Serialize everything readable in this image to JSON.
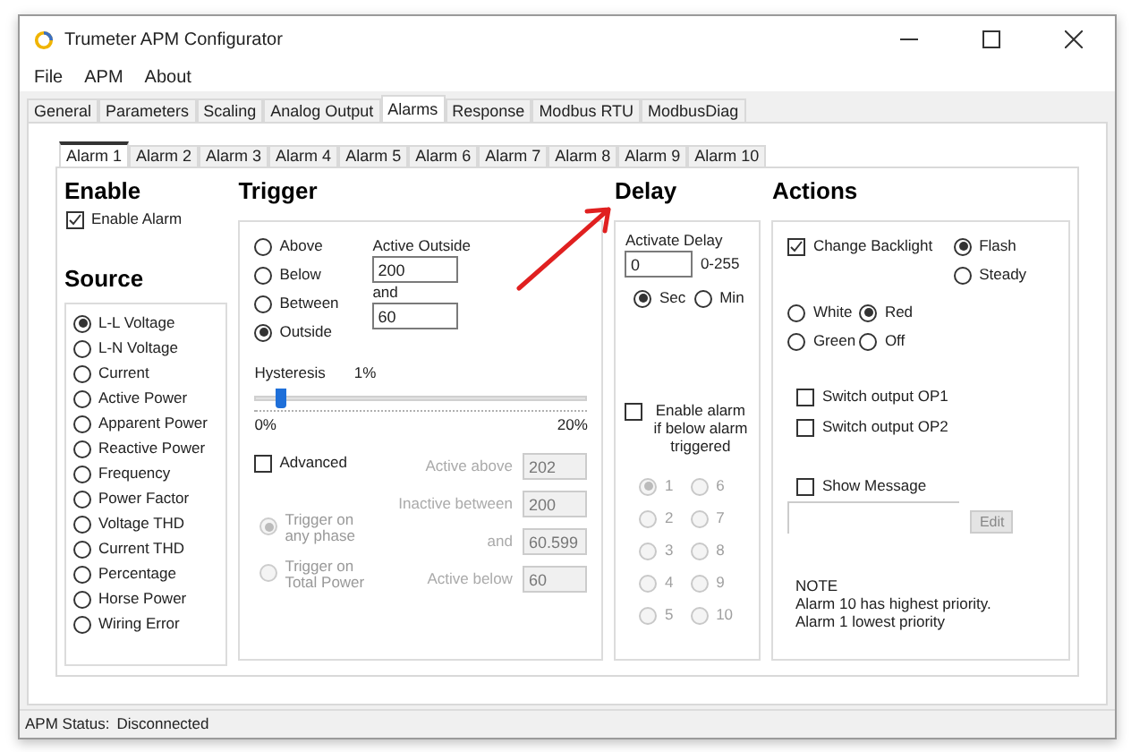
{
  "window": {
    "title": "Trumeter APM Configurator"
  },
  "menu": [
    "File",
    "APM",
    "About"
  ],
  "tabs": [
    {
      "label": "General",
      "selected": false
    },
    {
      "label": "Parameters",
      "selected": false
    },
    {
      "label": "Scaling",
      "selected": false
    },
    {
      "label": "Analog Output",
      "selected": false
    },
    {
      "label": "Alarms",
      "selected": true
    },
    {
      "label": "Response",
      "selected": false
    },
    {
      "label": "Modbus RTU",
      "selected": false
    },
    {
      "label": "ModbusDiag",
      "selected": false
    }
  ],
  "alarm_tabs": [
    {
      "label": "Alarm 1",
      "selected": true
    },
    {
      "label": "Alarm 2",
      "selected": false
    },
    {
      "label": "Alarm 3",
      "selected": false
    },
    {
      "label": "Alarm 4",
      "selected": false
    },
    {
      "label": "Alarm 5",
      "selected": false
    },
    {
      "label": "Alarm 6",
      "selected": false
    },
    {
      "label": "Alarm 7",
      "selected": false
    },
    {
      "label": "Alarm 8",
      "selected": false
    },
    {
      "label": "Alarm 9",
      "selected": false
    },
    {
      "label": "Alarm 10",
      "selected": false
    }
  ],
  "enable": {
    "heading": "Enable",
    "checkbox": {
      "label": "Enable Alarm",
      "checked": true
    }
  },
  "source": {
    "heading": "Source",
    "options": [
      {
        "label": "L-L Voltage",
        "selected": true
      },
      {
        "label": "L-N Voltage",
        "selected": false
      },
      {
        "label": "Current",
        "selected": false
      },
      {
        "label": "Active Power",
        "selected": false
      },
      {
        "label": "Apparent Power",
        "selected": false
      },
      {
        "label": "Reactive Power",
        "selected": false
      },
      {
        "label": "Frequency",
        "selected": false
      },
      {
        "label": "Power Factor",
        "selected": false
      },
      {
        "label": "Voltage THD",
        "selected": false
      },
      {
        "label": "Current THD",
        "selected": false
      },
      {
        "label": "Percentage",
        "selected": false
      },
      {
        "label": "Horse Power",
        "selected": false
      },
      {
        "label": "Wiring Error",
        "selected": false
      }
    ]
  },
  "trigger": {
    "heading": "Trigger",
    "modes": [
      {
        "label": "Above",
        "selected": false
      },
      {
        "label": "Below",
        "selected": false
      },
      {
        "label": "Between",
        "selected": false
      },
      {
        "label": "Outside",
        "selected": true
      }
    ],
    "active_label": "Active Outside",
    "value_1": "200",
    "and_label": "and",
    "value_2": "60",
    "hysteresis": {
      "label": "Hysteresis",
      "reading": "1%",
      "level": 0.05,
      "min": "0%",
      "max": "20%"
    },
    "advanced": {
      "label": "Advanced",
      "checked": false
    },
    "phase_options": [
      {
        "label": "Trigger on any phase",
        "selected": true,
        "disabled": true
      },
      {
        "label": "Trigger on Total Power",
        "selected": false,
        "disabled": true
      }
    ],
    "advanced_fields": [
      {
        "label": "Active above",
        "value": "202",
        "disabled": true
      },
      {
        "label": "Inactive between",
        "value": "200",
        "disabled": true
      },
      {
        "label": "and",
        "value": "60.599",
        "disabled": true
      },
      {
        "label": "Active below",
        "value": "60",
        "disabled": true
      }
    ]
  },
  "delay": {
    "heading": "Delay",
    "label": "Activate Delay",
    "value": "0",
    "range": "0-255",
    "units": [
      {
        "label": "Sec",
        "selected": true
      },
      {
        "label": "Min",
        "selected": false
      }
    ],
    "enable_below": {
      "label": "Enable alarm if below alarm triggered",
      "checked": false
    },
    "alarms": [
      {
        "label": "1",
        "selected": true,
        "disabled": true
      },
      {
        "label": "2",
        "selected": false,
        "disabled": true
      },
      {
        "label": "3",
        "selected": false,
        "disabled": true
      },
      {
        "label": "4",
        "selected": false,
        "disabled": true
      },
      {
        "label": "5",
        "selected": false,
        "disabled": true
      },
      {
        "label": "6",
        "selected": false,
        "disabled": true
      },
      {
        "label": "7",
        "selected": false,
        "disabled": true
      },
      {
        "label": "8",
        "selected": false,
        "disabled": true
      },
      {
        "label": "9",
        "selected": false,
        "disabled": true
      },
      {
        "label": "10",
        "selected": false,
        "disabled": true
      }
    ]
  },
  "actions": {
    "heading": "Actions",
    "change_backlight": {
      "label": "Change Backlight",
      "checked": true
    },
    "backlight_modes": [
      {
        "label": "Flash",
        "selected": true
      },
      {
        "label": "Steady",
        "selected": false
      }
    ],
    "colors": [
      {
        "label": "White",
        "selected": false
      },
      {
        "label": "Red",
        "selected": true
      },
      {
        "label": "Green",
        "selected": false
      },
      {
        "label": "Off",
        "selected": false
      }
    ],
    "outputs": [
      {
        "label": "Switch output OP1",
        "checked": false
      },
      {
        "label": "Switch output OP2",
        "checked": false
      }
    ],
    "show_message": {
      "label": "Show Message",
      "checked": false
    },
    "edit_button": {
      "label": "Edit",
      "disabled": true
    },
    "note": [
      "NOTE",
      "Alarm 10 has highest priority.",
      "Alarm 1 lowest priority"
    ]
  },
  "status": {
    "label": "APM Status:",
    "value": "Disconnected"
  }
}
